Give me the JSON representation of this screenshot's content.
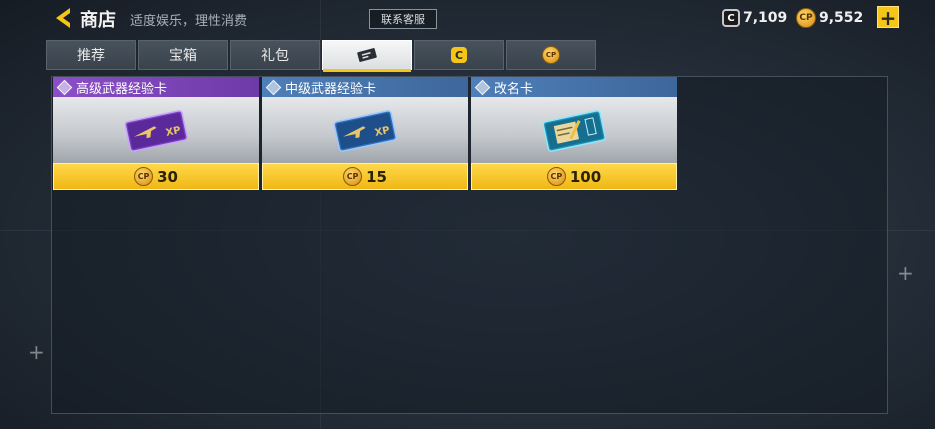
{
  "header": {
    "title": "商店",
    "subtitle": "适度娱乐，理性消费",
    "support_label": "联系客服"
  },
  "currencies": {
    "c_points": "7,109",
    "cp_points": "9,552",
    "c_icon_label": "C",
    "cp_icon_label": "CP",
    "add_label": "+"
  },
  "tabs": [
    {
      "label": "推荐",
      "icon": null,
      "active": false
    },
    {
      "label": "宝箱",
      "icon": null,
      "active": false
    },
    {
      "label": "礼包",
      "icon": null,
      "active": false
    },
    {
      "label": "",
      "icon": "ticket-icon",
      "active": true
    },
    {
      "label": "C",
      "icon": "c-currency-icon",
      "active": false
    },
    {
      "label": "CP",
      "icon": "cp-currency-icon",
      "active": false
    }
  ],
  "items": [
    {
      "name": "高级武器经验卡",
      "price": "30",
      "price_icon": "CP",
      "rarity_color": "#8a4fc7",
      "art": "purple-weapon-xp-card"
    },
    {
      "name": "中级武器经验卡",
      "price": "15",
      "price_icon": "CP",
      "rarity_color": "#4f7fb8",
      "art": "blue-weapon-xp-card"
    },
    {
      "name": "改名卡",
      "price": "100",
      "price_icon": "CP",
      "rarity_color": "#4f7fb8",
      "art": "rename-card"
    }
  ],
  "colors": {
    "accent_yellow": "#f5c617",
    "epic_purple": "#8a4fc7",
    "rare_blue": "#4f7fb8"
  }
}
